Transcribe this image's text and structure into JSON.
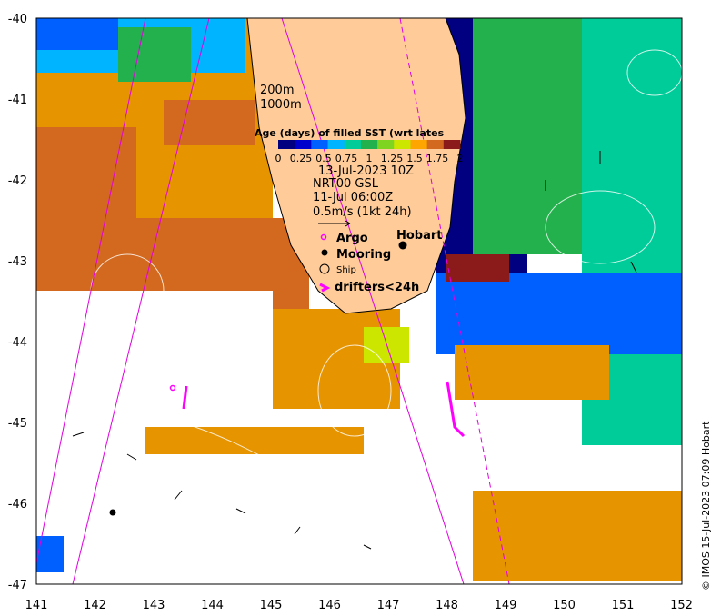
{
  "map": {
    "x_ticks": [
      "141",
      "142",
      "143",
      "144",
      "145",
      "146",
      "147",
      "148",
      "149",
      "150",
      "151",
      "152"
    ],
    "y_ticks": [
      "-40",
      "-41",
      "-42",
      "-43",
      "-44",
      "-45",
      "-46",
      "-47"
    ],
    "lon_range": [
      141,
      152
    ],
    "lat_range": [
      -47,
      -40
    ]
  },
  "legend": {
    "depth_200": "200m",
    "depth_1000": "1000m",
    "colorbar_title": "Age (days) of filled SST (wrt lates",
    "colorbar_ticks": [
      "0",
      "0.25",
      "0.5",
      "0.75",
      "1",
      "1.25",
      "1.5",
      "1.75",
      "2"
    ],
    "colorbar_colors": [
      "#000080",
      "#0000cd",
      "#0060ff",
      "#00b4ff",
      "#00cc99",
      "#22b14c",
      "#7fd321",
      "#cce600",
      "#ffa500",
      "#d2691e",
      "#8b1a1a"
    ],
    "sst_date": "13-Jul-2023 10Z",
    "model": "NRT00 GSL",
    "model_date": "11-Jul 06:00Z",
    "current_scale": "0.5m/s (1kt 24h)",
    "argo": "Argo",
    "mooring": "Mooring",
    "ship": "Ship",
    "drifters": "drifters<24h",
    "city": "Hobart"
  },
  "copyright": "© IMOS 15-Jul-2023 07:09 Hobart"
}
